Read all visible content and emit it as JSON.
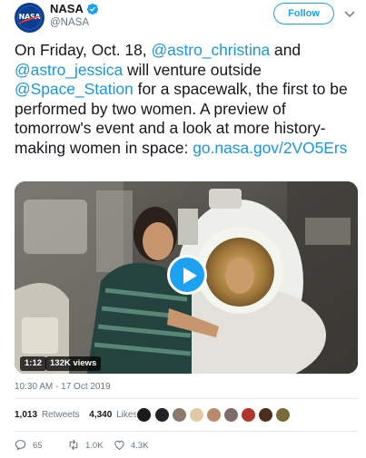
{
  "author": {
    "name": "NASA",
    "handle": "@NASA",
    "avatar_icon": "nasa-meatball-logo",
    "avatar_text": "NASA",
    "verified_icon": "verified-badge-icon"
  },
  "header": {
    "follow_label": "Follow",
    "menu_icon": "chevron-down-icon"
  },
  "tweet": {
    "text_parts": [
      "On Friday, Oct. 18, ",
      "@astro_christina",
      " and ",
      "@astro_jessica",
      " will venture outside ",
      "@Space_Station",
      " for a spacewalk, the first to be performed by two women. A preview of tomorrow's event and a look at more history-making women in space: ",
      "go.nasa.gov/2VO5Ers"
    ]
  },
  "media": {
    "type": "video",
    "duration": "1:12",
    "views": "132K views",
    "play_icon": "play-icon"
  },
  "timestamp": "10:30 AM - 17 Oct 2019",
  "stats": {
    "retweets_count": "1,013",
    "retweets_label": "Retweets",
    "likes_count": "4,340",
    "likes_label": "Likes"
  },
  "actions": {
    "reply_count": "65",
    "retweet_count": "1.0K",
    "like_count": "4.3K"
  },
  "colors": {
    "accent": "#1da1f2",
    "link": "#1b95e0",
    "muted": "#657786"
  }
}
